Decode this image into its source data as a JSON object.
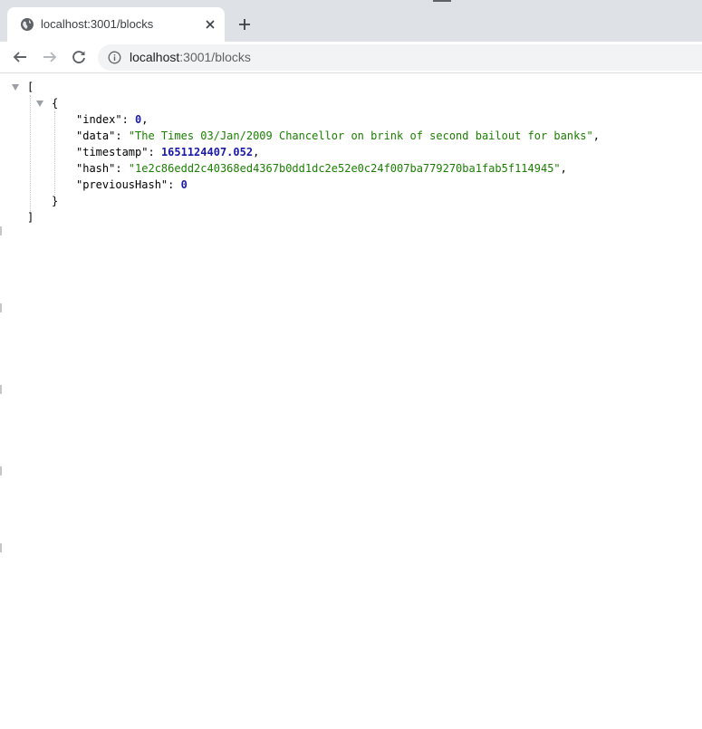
{
  "browser": {
    "tab_title": "localhost:3001/blocks",
    "url_host": "localhost",
    "url_path": ":3001/blocks"
  },
  "json_view": {
    "open_array": "[",
    "close_array": "]",
    "open_object": "{",
    "close_object": "}",
    "entries": [
      {
        "key": "\"index\"",
        "value": "0",
        "value_type": "number"
      },
      {
        "key": "\"data\"",
        "value": "\"The Times 03/Jan/2009 Chancellor on brink of second bailout for banks\"",
        "value_type": "string"
      },
      {
        "key": "\"timestamp\"",
        "value": "1651124407.052",
        "value_type": "number"
      },
      {
        "key": "\"hash\"",
        "value": "\"1e2c86edd2c40368ed4367b0dd1dc2e52e0c24f007ba779270ba1fab5f114945\"",
        "value_type": "string"
      },
      {
        "key": "\"previousHash\"",
        "value": "0",
        "value_type": "number"
      }
    ]
  },
  "colors": {
    "string": "#1a7f00",
    "number": "#1a1aa6",
    "tabstrip": "#dee1e6",
    "omnibox": "#f1f3f4"
  }
}
